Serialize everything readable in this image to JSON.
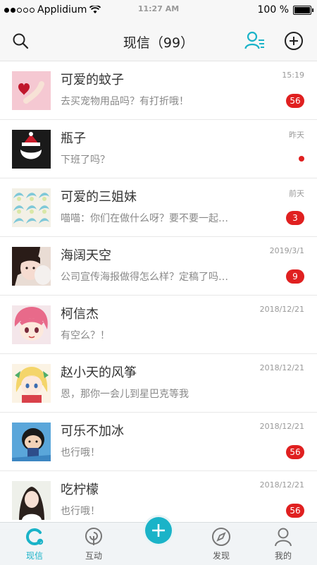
{
  "status_bar": {
    "carrier": "Applidium",
    "time": "11:27 AM",
    "battery": "100 %"
  },
  "header": {
    "title": "现信（99）"
  },
  "conversations": [
    {
      "name": "可爱的蚊子",
      "preview": "去买宠物用品吗？有打折哦！",
      "time": "15:19",
      "badge": "56",
      "dot": false
    },
    {
      "name": "瓶子",
      "preview": "下班了吗？",
      "time": "昨天",
      "badge": "",
      "dot": true
    },
    {
      "name": "可爱的三姐妹",
      "preview": "喵喵：你们在做什么呀？要不要一起…",
      "time": "前天",
      "badge": "3",
      "dot": false
    },
    {
      "name": "海阔天空",
      "preview": "公司宣传海报做得怎么样？定稿了吗…",
      "time": "2019/3/1",
      "badge": "9",
      "dot": false
    },
    {
      "name": "柯信杰",
      "preview": "有空么？！",
      "time": "2018/12/21",
      "badge": "",
      "dot": false
    },
    {
      "name": "赵小天的风筝",
      "preview": "恩，那你一会儿到星巴克等我",
      "time": "2018/12/21",
      "badge": "",
      "dot": false
    },
    {
      "name": "可乐不加冰",
      "preview": "也行哦！",
      "time": "2018/12/21",
      "badge": "56",
      "dot": false
    },
    {
      "name": "吃柠檬",
      "preview": "也行哦！",
      "time": "2018/12/21",
      "badge": "56",
      "dot": false
    }
  ],
  "tabs": [
    {
      "label": "现信",
      "icon": "chat-bubble-icon",
      "active": true
    },
    {
      "label": "互动",
      "icon": "interact-icon",
      "active": false
    },
    {
      "label": "发现",
      "icon": "compass-icon",
      "active": false
    },
    {
      "label": "我的",
      "icon": "profile-icon",
      "active": false
    }
  ],
  "colors": {
    "accent": "#1ab3c8",
    "badge": "#e02020"
  }
}
